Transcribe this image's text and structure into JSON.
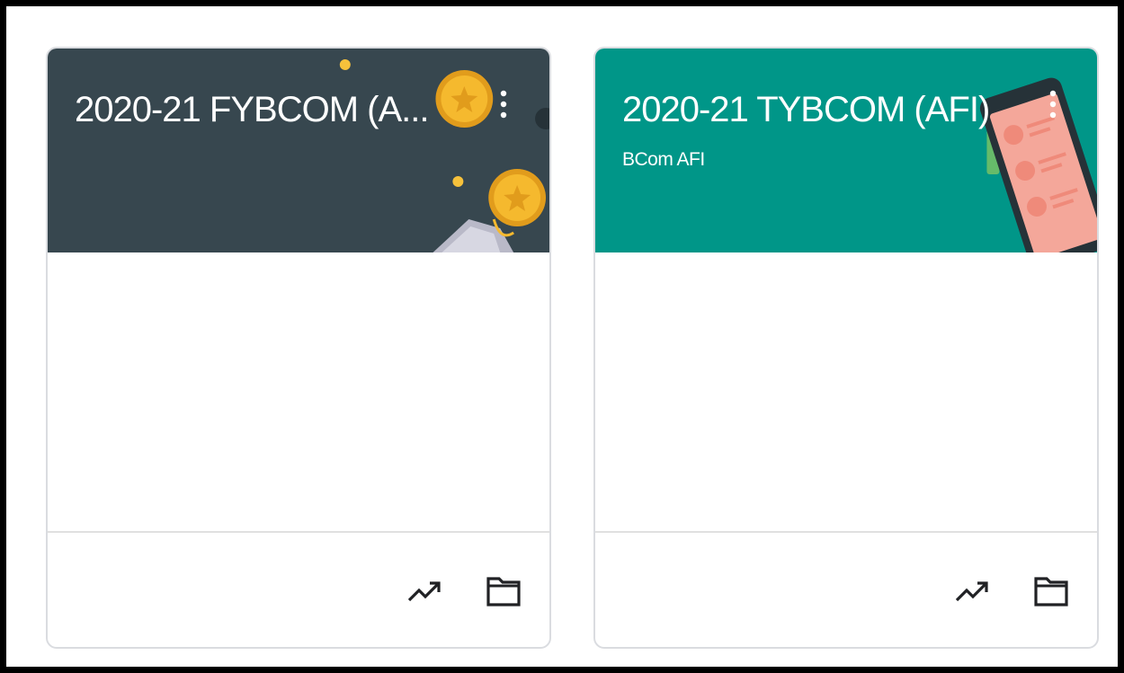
{
  "cards": [
    {
      "title": "2020-21 FYBCOM (A...",
      "subtitle": "",
      "banner_color": "#37474f",
      "banner_illustration": "coins",
      "menu_icon": "more-vert-icon",
      "footer_icons": [
        "trending-up-icon",
        "folder-icon"
      ]
    },
    {
      "title": "2020-21 TYBCOM (AFI)",
      "subtitle": "BCom AFI",
      "banner_color": "#009688",
      "banner_illustration": "phone-with-contacts",
      "menu_icon": "more-vert-icon",
      "footer_icons": [
        "trending-up-icon",
        "folder-icon"
      ]
    }
  ]
}
